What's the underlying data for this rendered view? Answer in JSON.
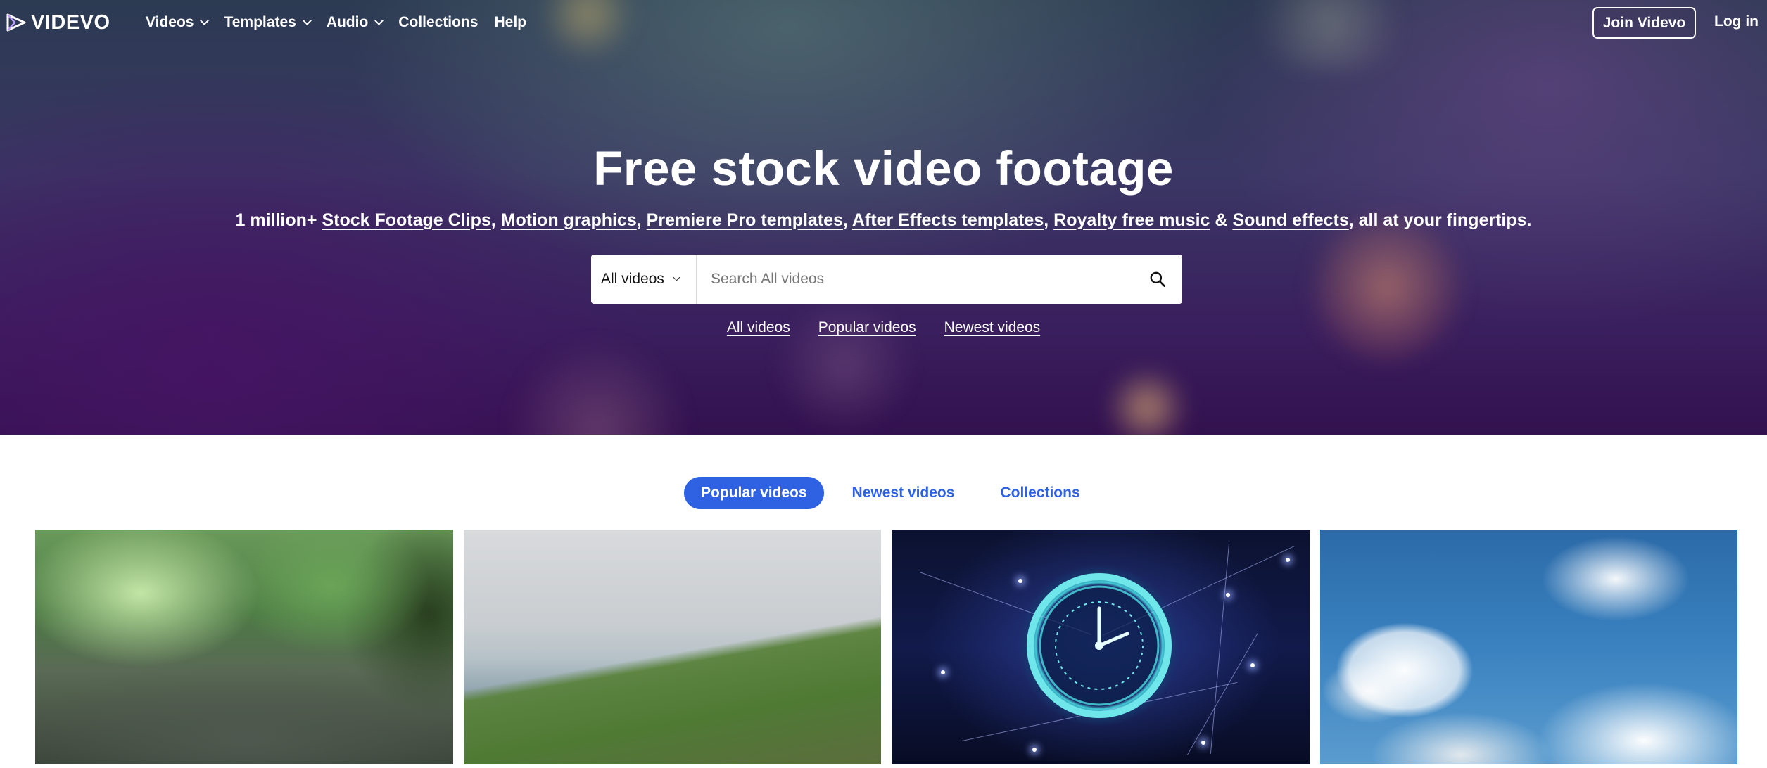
{
  "brand": {
    "name": "VIDEVO"
  },
  "nav": {
    "items": [
      {
        "label": "Videos",
        "dropdown": true
      },
      {
        "label": "Templates",
        "dropdown": true
      },
      {
        "label": "Audio",
        "dropdown": true
      },
      {
        "label": "Collections",
        "dropdown": false
      },
      {
        "label": "Help",
        "dropdown": false
      }
    ],
    "join_label": "Join Videvo",
    "login_label": "Log in"
  },
  "hero": {
    "title": "Free stock video footage",
    "subtitle": {
      "prefix": "1 million+",
      "links": [
        "Stock Footage Clips",
        "Motion graphics",
        "Premiere Pro templates",
        "After Effects templates",
        "Royalty free music",
        "Sound effects"
      ],
      "ampersand": "&",
      "suffix": ", all at your fingertips."
    }
  },
  "search": {
    "type_value": "All videos",
    "placeholder": "Search All videos",
    "icon": "search-icon"
  },
  "quick_links": [
    "All videos",
    "Popular videos",
    "Newest videos"
  ],
  "tabs": [
    {
      "label": "Popular videos",
      "active": true
    },
    {
      "label": "Newest videos",
      "active": false
    },
    {
      "label": "Collections",
      "active": false
    }
  ],
  "colors": {
    "accent": "#2f62e3",
    "hero_dark": "#33114f"
  }
}
